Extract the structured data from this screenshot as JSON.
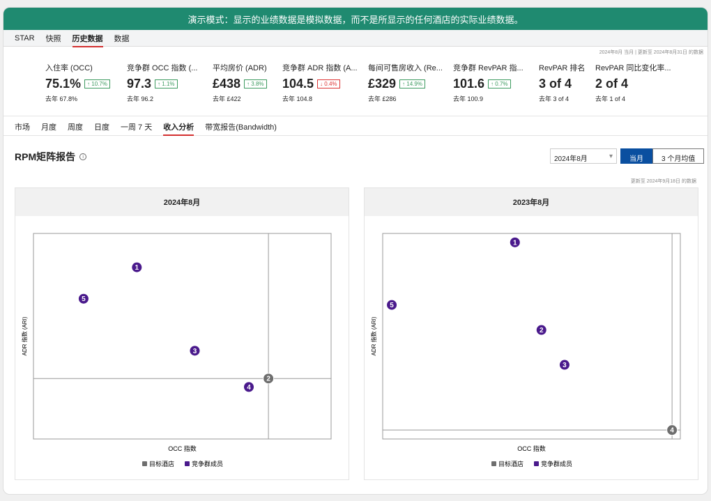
{
  "banner": "演示模式：显示的业绩数据是模拟数据，而不是所显示的任何酒店的实际业绩数据。",
  "nav": [
    "STAR",
    "快照",
    "历史数据",
    "数据"
  ],
  "nav_active": 2,
  "updated": "2024年8月 当月 | 更新至 2024年8月31日 的数据",
  "kpis": [
    {
      "label": "入住率 (OCC)",
      "value": "75.1%",
      "change": "↑ 10.7%",
      "dir": "up",
      "last_year": "去年  67.8%"
    },
    {
      "label": "竞争群 OCC 指数 (...",
      "value": "97.3",
      "change": "↑ 1.1%",
      "dir": "up",
      "last_year": "去年  96.2"
    },
    {
      "label": "平均房价 (ADR)",
      "value": "£438",
      "change": "↑ 3.8%",
      "dir": "up",
      "last_year": "去年  £422"
    },
    {
      "label": "竞争群 ADR 指数 (A...",
      "value": "104.5",
      "change": "↓ 0.4%",
      "dir": "down",
      "last_year": "去年  104.8"
    },
    {
      "label": "每间可售房收入 (Re...",
      "value": "£329",
      "change": "↑ 14.9%",
      "dir": "up",
      "last_year": "去年  £286"
    },
    {
      "label": "竞争群 RevPAR 指...",
      "value": "101.6",
      "change": "↑ 0.7%",
      "dir": "up",
      "last_year": "去年  100.9"
    },
    {
      "label": "RevPAR 排名",
      "value": "3 of 4",
      "change": null,
      "last_year": "去年  3 of 4"
    },
    {
      "label": "RevPAR 同比变化率...",
      "value": "2 of 4",
      "change": null,
      "last_year": "去年  1 of 4"
    }
  ],
  "subnav": [
    "市场",
    "月度",
    "周度",
    "日度",
    "一周 7 天",
    "收入分析",
    "带宽报告(Bandwidth)"
  ],
  "subnav_active": 5,
  "report_title": "RPM矩阵报告",
  "period_select": "2024年8月",
  "toggle": {
    "current": "当月",
    "avg": "3 个月均值"
  },
  "updated2": "更新至 2024年9月18日 的数据",
  "colors": {
    "target": "#6e6e6e",
    "comp": "#4a1a8c",
    "accent": "#0a4fa0",
    "banner": "#1f8a70"
  },
  "chart_data": [
    {
      "type": "scatter",
      "title": "2024年8月",
      "xlabel": "OCC 指数",
      "ylabel": "ADR 指数 (ARI)",
      "xlim": [
        70,
        108
      ],
      "ylim": [
        95,
        112
      ],
      "reference_lines": {
        "x": 100,
        "y": 100
      },
      "legend": [
        "目标酒店",
        "竞争群成员"
      ],
      "legend_position": "bottom",
      "points": [
        {
          "label": "1",
          "x": 83.2,
          "y": 109.2,
          "group": "comp"
        },
        {
          "label": "2",
          "x": 100,
          "y": 100,
          "group": "target"
        },
        {
          "label": "3",
          "x": 90.6,
          "y": 102.3,
          "group": "comp"
        },
        {
          "label": "4",
          "x": 97.5,
          "y": 99.3,
          "group": "comp"
        },
        {
          "label": "5",
          "x": 76.4,
          "y": 106.6,
          "group": "comp"
        }
      ]
    },
    {
      "type": "scatter",
      "title": "2023年8月",
      "xlabel": "OCC 指数",
      "ylabel": "ADR 指数 (ARI)",
      "xlim": [
        65,
        101
      ],
      "ylim": [
        99,
        122
      ],
      "reference_lines": {
        "x": 100,
        "y": 100
      },
      "legend": [
        "目标酒店",
        "竞争群成员"
      ],
      "legend_position": "bottom",
      "points": [
        {
          "label": "1",
          "x": 81.0,
          "y": 121.0,
          "group": "comp"
        },
        {
          "label": "2",
          "x": 84.2,
          "y": 111.2,
          "group": "comp"
        },
        {
          "label": "3",
          "x": 87.0,
          "y": 107.3,
          "group": "comp"
        },
        {
          "label": "4",
          "x": 100,
          "y": 100,
          "group": "target"
        },
        {
          "label": "5",
          "x": 66.1,
          "y": 114.0,
          "group": "comp"
        }
      ]
    }
  ]
}
